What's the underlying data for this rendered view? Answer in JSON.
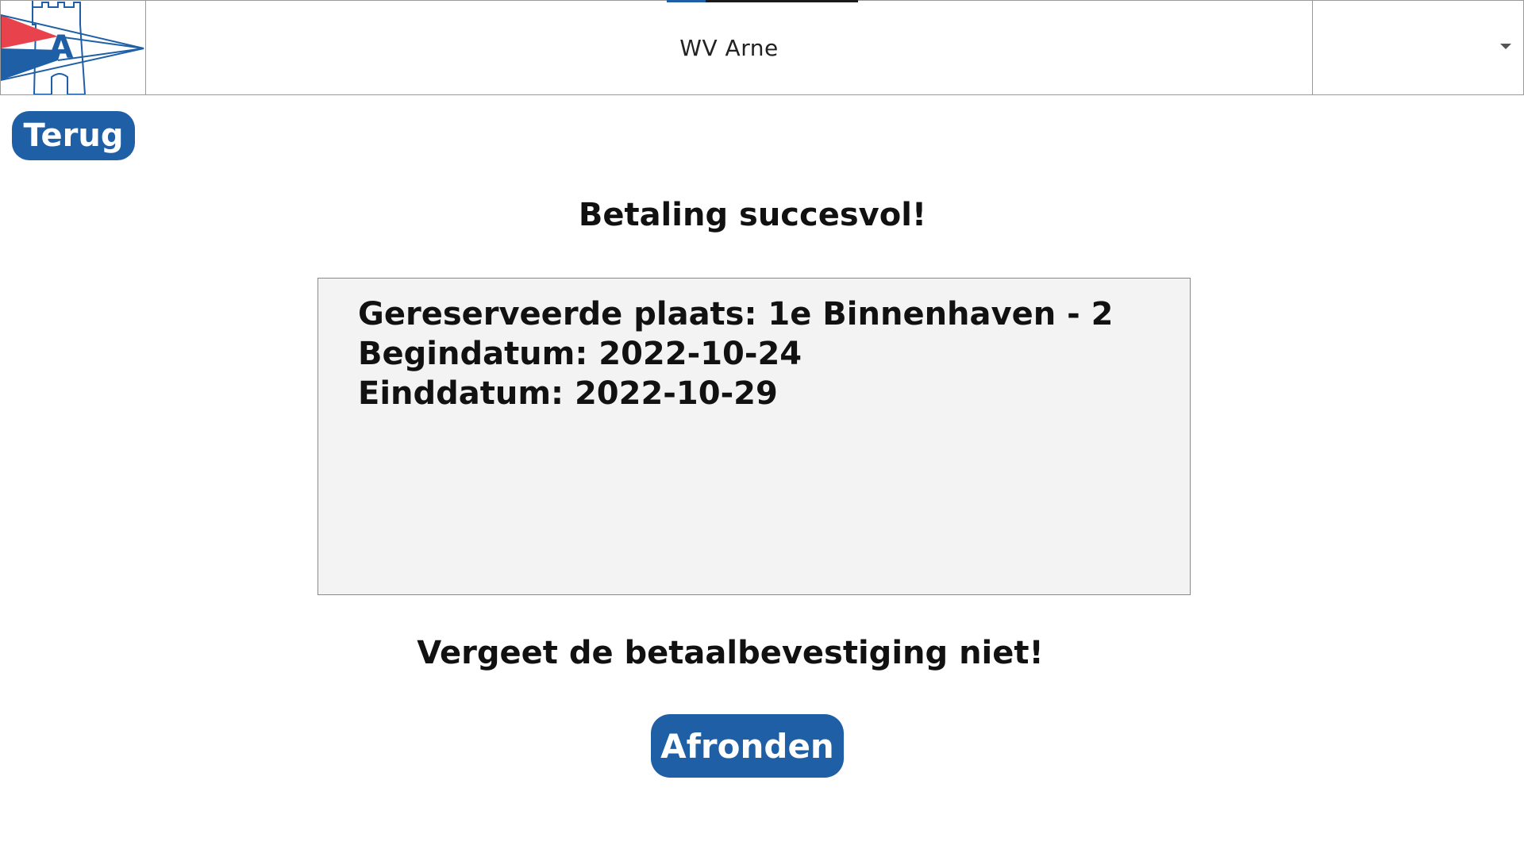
{
  "header": {
    "title": "WV Arne",
    "logo": {
      "letter": "A",
      "icon": "club-pennant-logo",
      "colors": {
        "red": "#e8434c",
        "blue": "#1e5fa6"
      }
    },
    "dropdown": {
      "value": "",
      "icon": "chevron-down-icon"
    }
  },
  "back_button": {
    "label": "Terug"
  },
  "main": {
    "title": "Betaling succesvol!",
    "details": {
      "line1": "Gereserveerde plaats: 1e Binnenhaven - 2",
      "line2": "Begindatum: 2022-10-24",
      "line3": "Einddatum: 2022-10-29"
    },
    "reminder": "Vergeet de betaalbevestiging niet!",
    "finish_button": {
      "label": "Afronden"
    }
  },
  "colors": {
    "accent": "#1e5fa6",
    "details_background": "#f3f3f3"
  }
}
